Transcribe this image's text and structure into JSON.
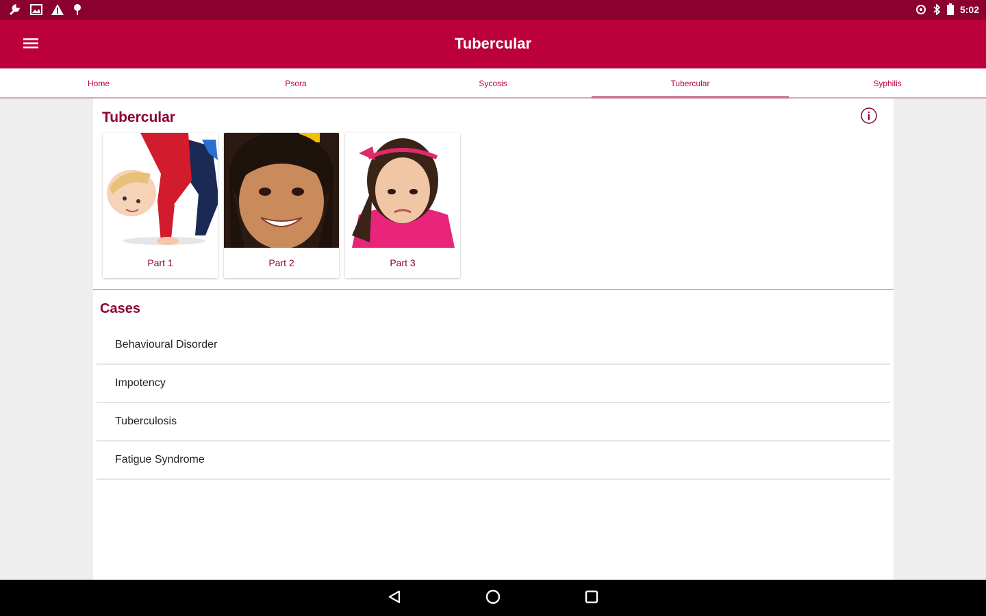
{
  "status_bar": {
    "time": "5:02",
    "left_icons": [
      "wrench-icon",
      "image-icon",
      "warning-icon",
      "pin-icon"
    ],
    "right_icons": [
      "vibrate-icon",
      "bluetooth-icon",
      "battery-icon"
    ]
  },
  "app_bar": {
    "title": "Tubercular",
    "background": "#bb003c"
  },
  "tabs": [
    {
      "label": "Home",
      "active": false
    },
    {
      "label": "Psora",
      "active": false
    },
    {
      "label": "Sycosis",
      "active": false
    },
    {
      "label": "Tubercular",
      "active": true
    },
    {
      "label": "Syphilis",
      "active": false
    }
  ],
  "section": {
    "title": "Tubercular",
    "parts": [
      {
        "label": "Part 1"
      },
      {
        "label": "Part 2"
      },
      {
        "label": "Part 3"
      }
    ]
  },
  "cases": {
    "title": "Cases",
    "items": [
      "Behavioural Disorder",
      "Impotency",
      "Tuberculosis",
      "Fatigue Syndrome"
    ]
  },
  "colors": {
    "accent": "#bb003c",
    "status_bar": "#8c0030",
    "heading": "#8c0030"
  }
}
